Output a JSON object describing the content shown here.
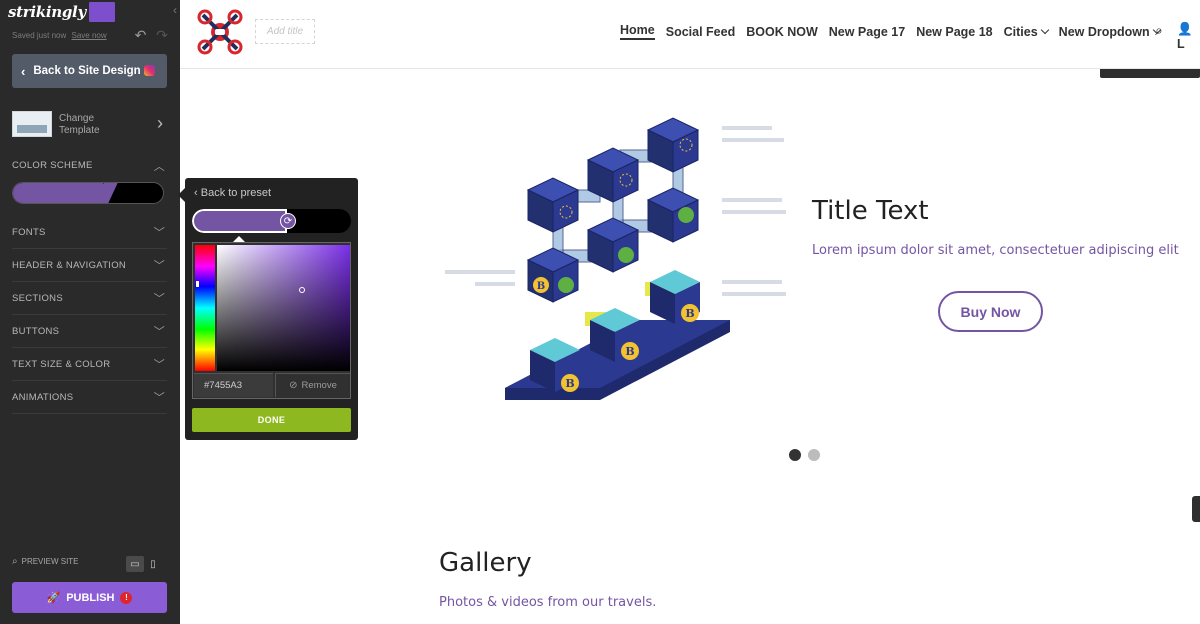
{
  "editor": {
    "brand": "strikingly",
    "saved_status": "Saved just now",
    "save_now": "Save now",
    "back_button": "Back to Site Design",
    "change_template": "Change Template",
    "sections": [
      "COLOR SCHEME",
      "FONTS",
      "HEADER & NAVIGATION",
      "SECTIONS",
      "BUTTONS",
      "TEXT SIZE & COLOR",
      "ANIMATIONS"
    ],
    "preview": "PREVIEW SITE",
    "publish": "PUBLISH",
    "publish_alert": "!",
    "scheme_colors": [
      "#7455A3",
      "#000000"
    ]
  },
  "picker": {
    "back": "Back to preset",
    "hex": "#7455A3",
    "remove": "Remove",
    "done": "DONE"
  },
  "site": {
    "add_title": "Add title",
    "nav": [
      {
        "label": "Home",
        "active": true
      },
      {
        "label": "Social Feed"
      },
      {
        "label": "BOOK NOW"
      },
      {
        "label": "New Page 17"
      },
      {
        "label": "New Page 18"
      },
      {
        "label": "Cities",
        "dropdown": true
      },
      {
        "label": "New Dropdown",
        "dropdown": true
      }
    ],
    "user_initial": "L",
    "hero": {
      "title": "Title Text",
      "subtitle": "Lorem ipsum dolor sit amet, consectetuer adipiscing elit",
      "button": "Buy Now",
      "slide_count": 2,
      "active_slide": 1
    },
    "gallery": {
      "title": "Gallery",
      "subtitle": "Photos & videos from our travels."
    },
    "accent": "#7455A3"
  }
}
